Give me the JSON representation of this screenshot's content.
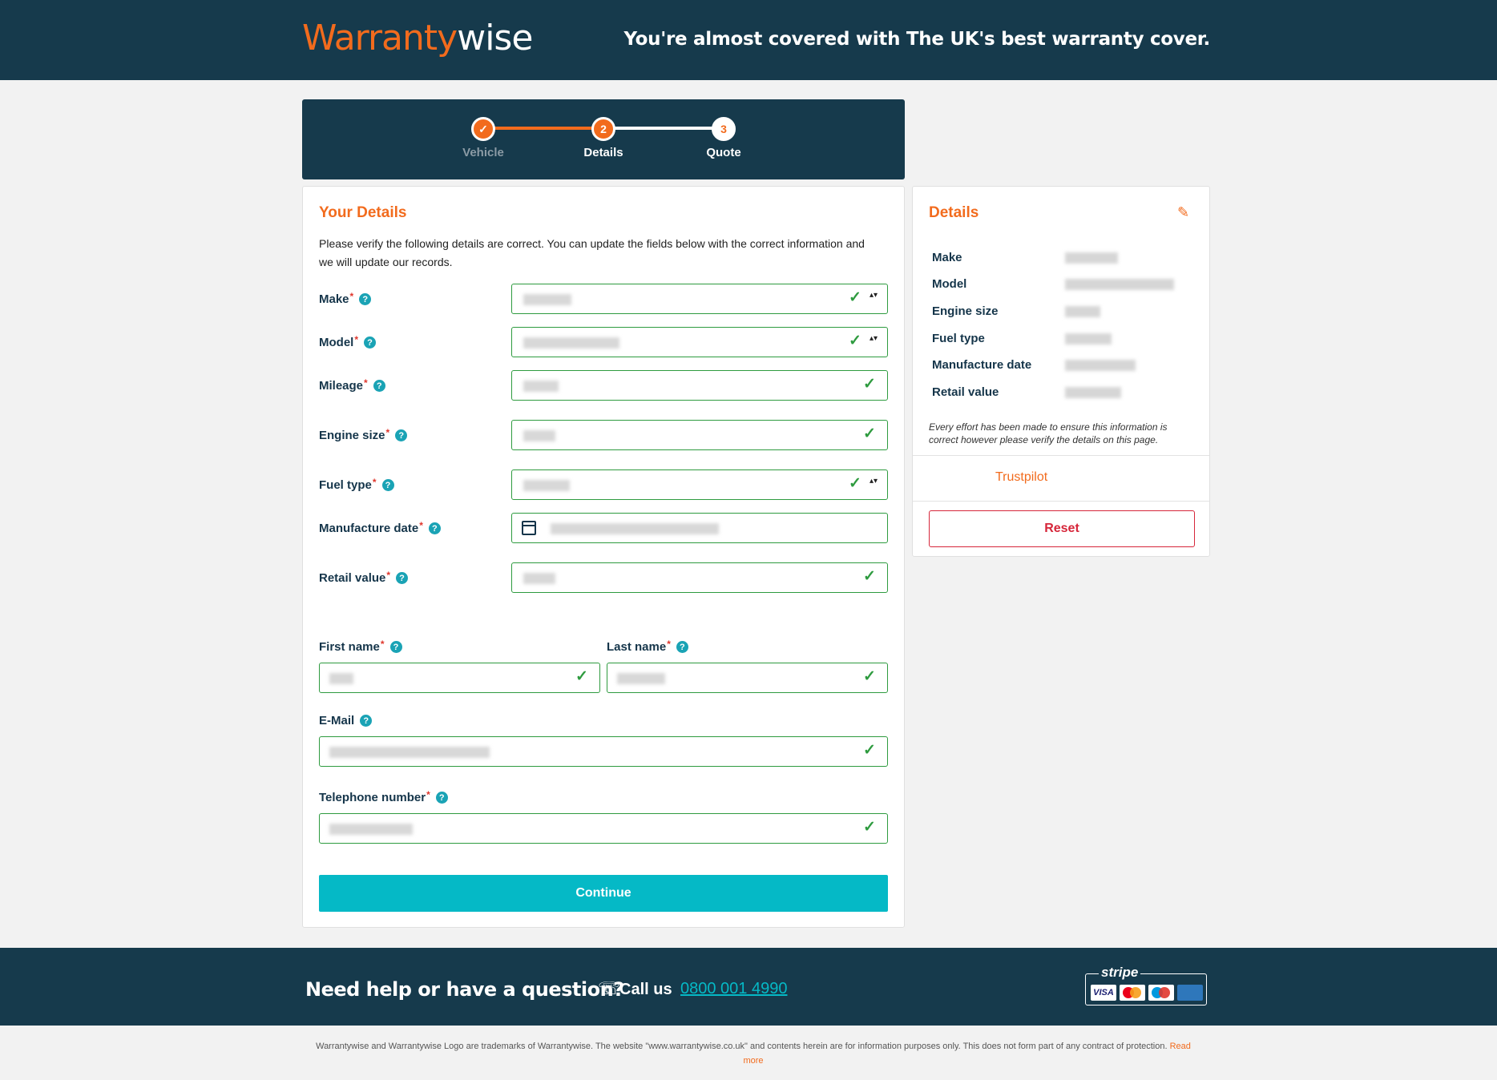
{
  "header": {
    "logo_part1": "Warranty",
    "logo_part2": "wise",
    "tagline": "You're almost covered with The UK's best warranty cover."
  },
  "stepper": {
    "steps": [
      {
        "label": "Vehicle",
        "marker": "✓",
        "state": "complete"
      },
      {
        "label": "Details",
        "marker": "2",
        "state": "current"
      },
      {
        "label": "Quote",
        "marker": "3",
        "state": "upcoming"
      }
    ]
  },
  "form": {
    "title": "Your Details",
    "intro": "Please verify the following details are correct. You can update the fields below with the correct information and we will update our records.",
    "fields": {
      "make": {
        "label": "Make",
        "required": "*"
      },
      "model": {
        "label": "Model",
        "required": "*"
      },
      "mileage": {
        "label": "Mileage",
        "required": "*"
      },
      "engine_size": {
        "label": "Engine size",
        "required": "*"
      },
      "fuel_type": {
        "label": "Fuel type",
        "required": "*"
      },
      "manufacture_date": {
        "label": "Manufacture date",
        "required": "*"
      },
      "retail_value": {
        "label": "Retail value",
        "required": "*"
      },
      "first_name": {
        "label": "First name",
        "required": "*"
      },
      "last_name": {
        "label": "Last name",
        "required": "*"
      },
      "email": {
        "label": "E-Mail"
      },
      "telephone": {
        "label": "Telephone number",
        "required": "*"
      }
    },
    "help_glyph": "?",
    "valid_glyph": "✓",
    "select_glyph": "▴▾",
    "continue_label": "Continue"
  },
  "summary": {
    "title": "Details",
    "rows": [
      "Make",
      "Model",
      "Engine size",
      "Fuel type",
      "Manufacture date",
      "Retail value"
    ],
    "disclaimer": "Every effort has been made to ensure this information is correct however please verify the details on this page.",
    "trustpilot": "Trustpilot",
    "reset_label": "Reset",
    "edit_glyph": "✎"
  },
  "footer": {
    "help_question": "Need help or have a question?",
    "call_label": "Call us",
    "phone": "0800 001 4990",
    "phone_glyph": "☏",
    "payment_provider": "stripe",
    "cards": {
      "visa": "VISA",
      "mastercard": "",
      "maestro": "",
      "amex": "AMEX"
    },
    "legal_text": "Warrantywise and Warrantywise Logo are trademarks of Warrantywise. The website \"www.warrantywise.co.uk\" and contents herein are for information purposes only. This does not form part of any contract of protection.",
    "read_more": "Read more"
  },
  "colors": {
    "navy": "#163a4c",
    "orange": "#f26b1d",
    "teal": "#05b9c6",
    "valid_green": "#2e9b3f",
    "danger_red": "#d6263a"
  }
}
